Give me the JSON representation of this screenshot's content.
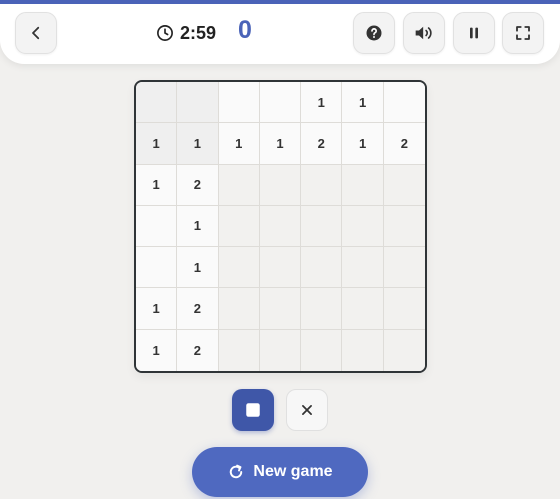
{
  "header": {
    "progress_percent": 100,
    "timer": "2:59",
    "score": "0",
    "icons": {
      "back": "chevron-left-icon",
      "clock": "clock-icon",
      "help": "question-icon",
      "sound": "volume-icon",
      "pause": "pause-icon",
      "fullscreen": "fullscreen-icon"
    }
  },
  "board": {
    "rows": [
      [
        "",
        "",
        "",
        "",
        "1",
        "1",
        ""
      ],
      [
        "1",
        "1",
        "1",
        "1",
        "2",
        "1",
        "2"
      ],
      [
        "1",
        "2",
        "",
        "",
        "",
        "",
        ""
      ],
      [
        "",
        "1",
        "",
        "",
        "",
        "",
        ""
      ],
      [
        "",
        "1",
        "",
        "",
        "",
        "",
        ""
      ],
      [
        "1",
        "2",
        "",
        "",
        "",
        "",
        ""
      ],
      [
        "1",
        "2",
        "",
        "",
        "",
        "",
        ""
      ]
    ],
    "clue_rows": 2,
    "clue_cols": 2
  },
  "modes": {
    "fill_icon": "filled-square-icon",
    "cross_icon": "cross-icon",
    "selected": "fill"
  },
  "actions": {
    "new_game_label": "New game",
    "new_game_icon": "refresh-icon"
  },
  "colors": {
    "accent": "#4a63b8",
    "button": "#4f69c0",
    "board_border": "#2f3437"
  }
}
